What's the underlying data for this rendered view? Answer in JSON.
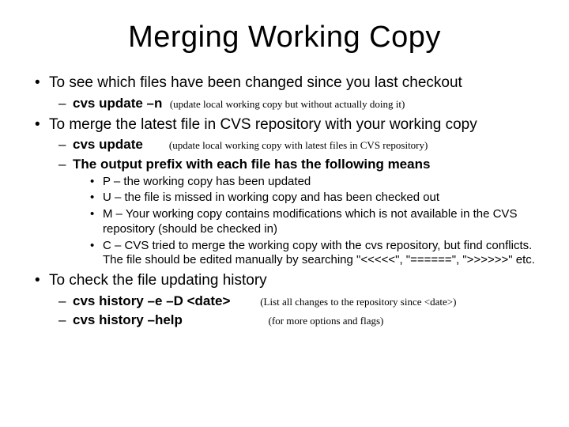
{
  "title": "Merging Working Copy",
  "b1": {
    "text": "To see which files have been changed since you last checkout",
    "s1_cmd": "cvs update –n",
    "s1_note": "(update local working copy but without actually doing it)"
  },
  "b2": {
    "text": "To merge the latest file in CVS repository with your working copy",
    "s1_cmd": "cvs update",
    "s1_note": "(update local working copy with latest files in CVS repository)",
    "s2_text": "The output prefix with each file has the following means",
    "p": "P – the working copy has been updated",
    "u": "U – the file is missed in working copy and has been checked out",
    "m": "M – Your working copy contains modifications which is not available in the CVS repository (should be checked in)",
    "c": "C – CVS tried to merge the working copy with the cvs repository, but find conflicts. The file should be edited manually by searching \"<<<<<\", \"======\", \">>>>>>\" etc."
  },
  "b3": {
    "text": "To check the file updating history",
    "s1_cmd": "cvs history –e –D <date>",
    "s1_note": "(List all changes to the repository since <date>)",
    "s2_cmd": "cvs history –help",
    "s2_note": "(for more options and flags)"
  }
}
